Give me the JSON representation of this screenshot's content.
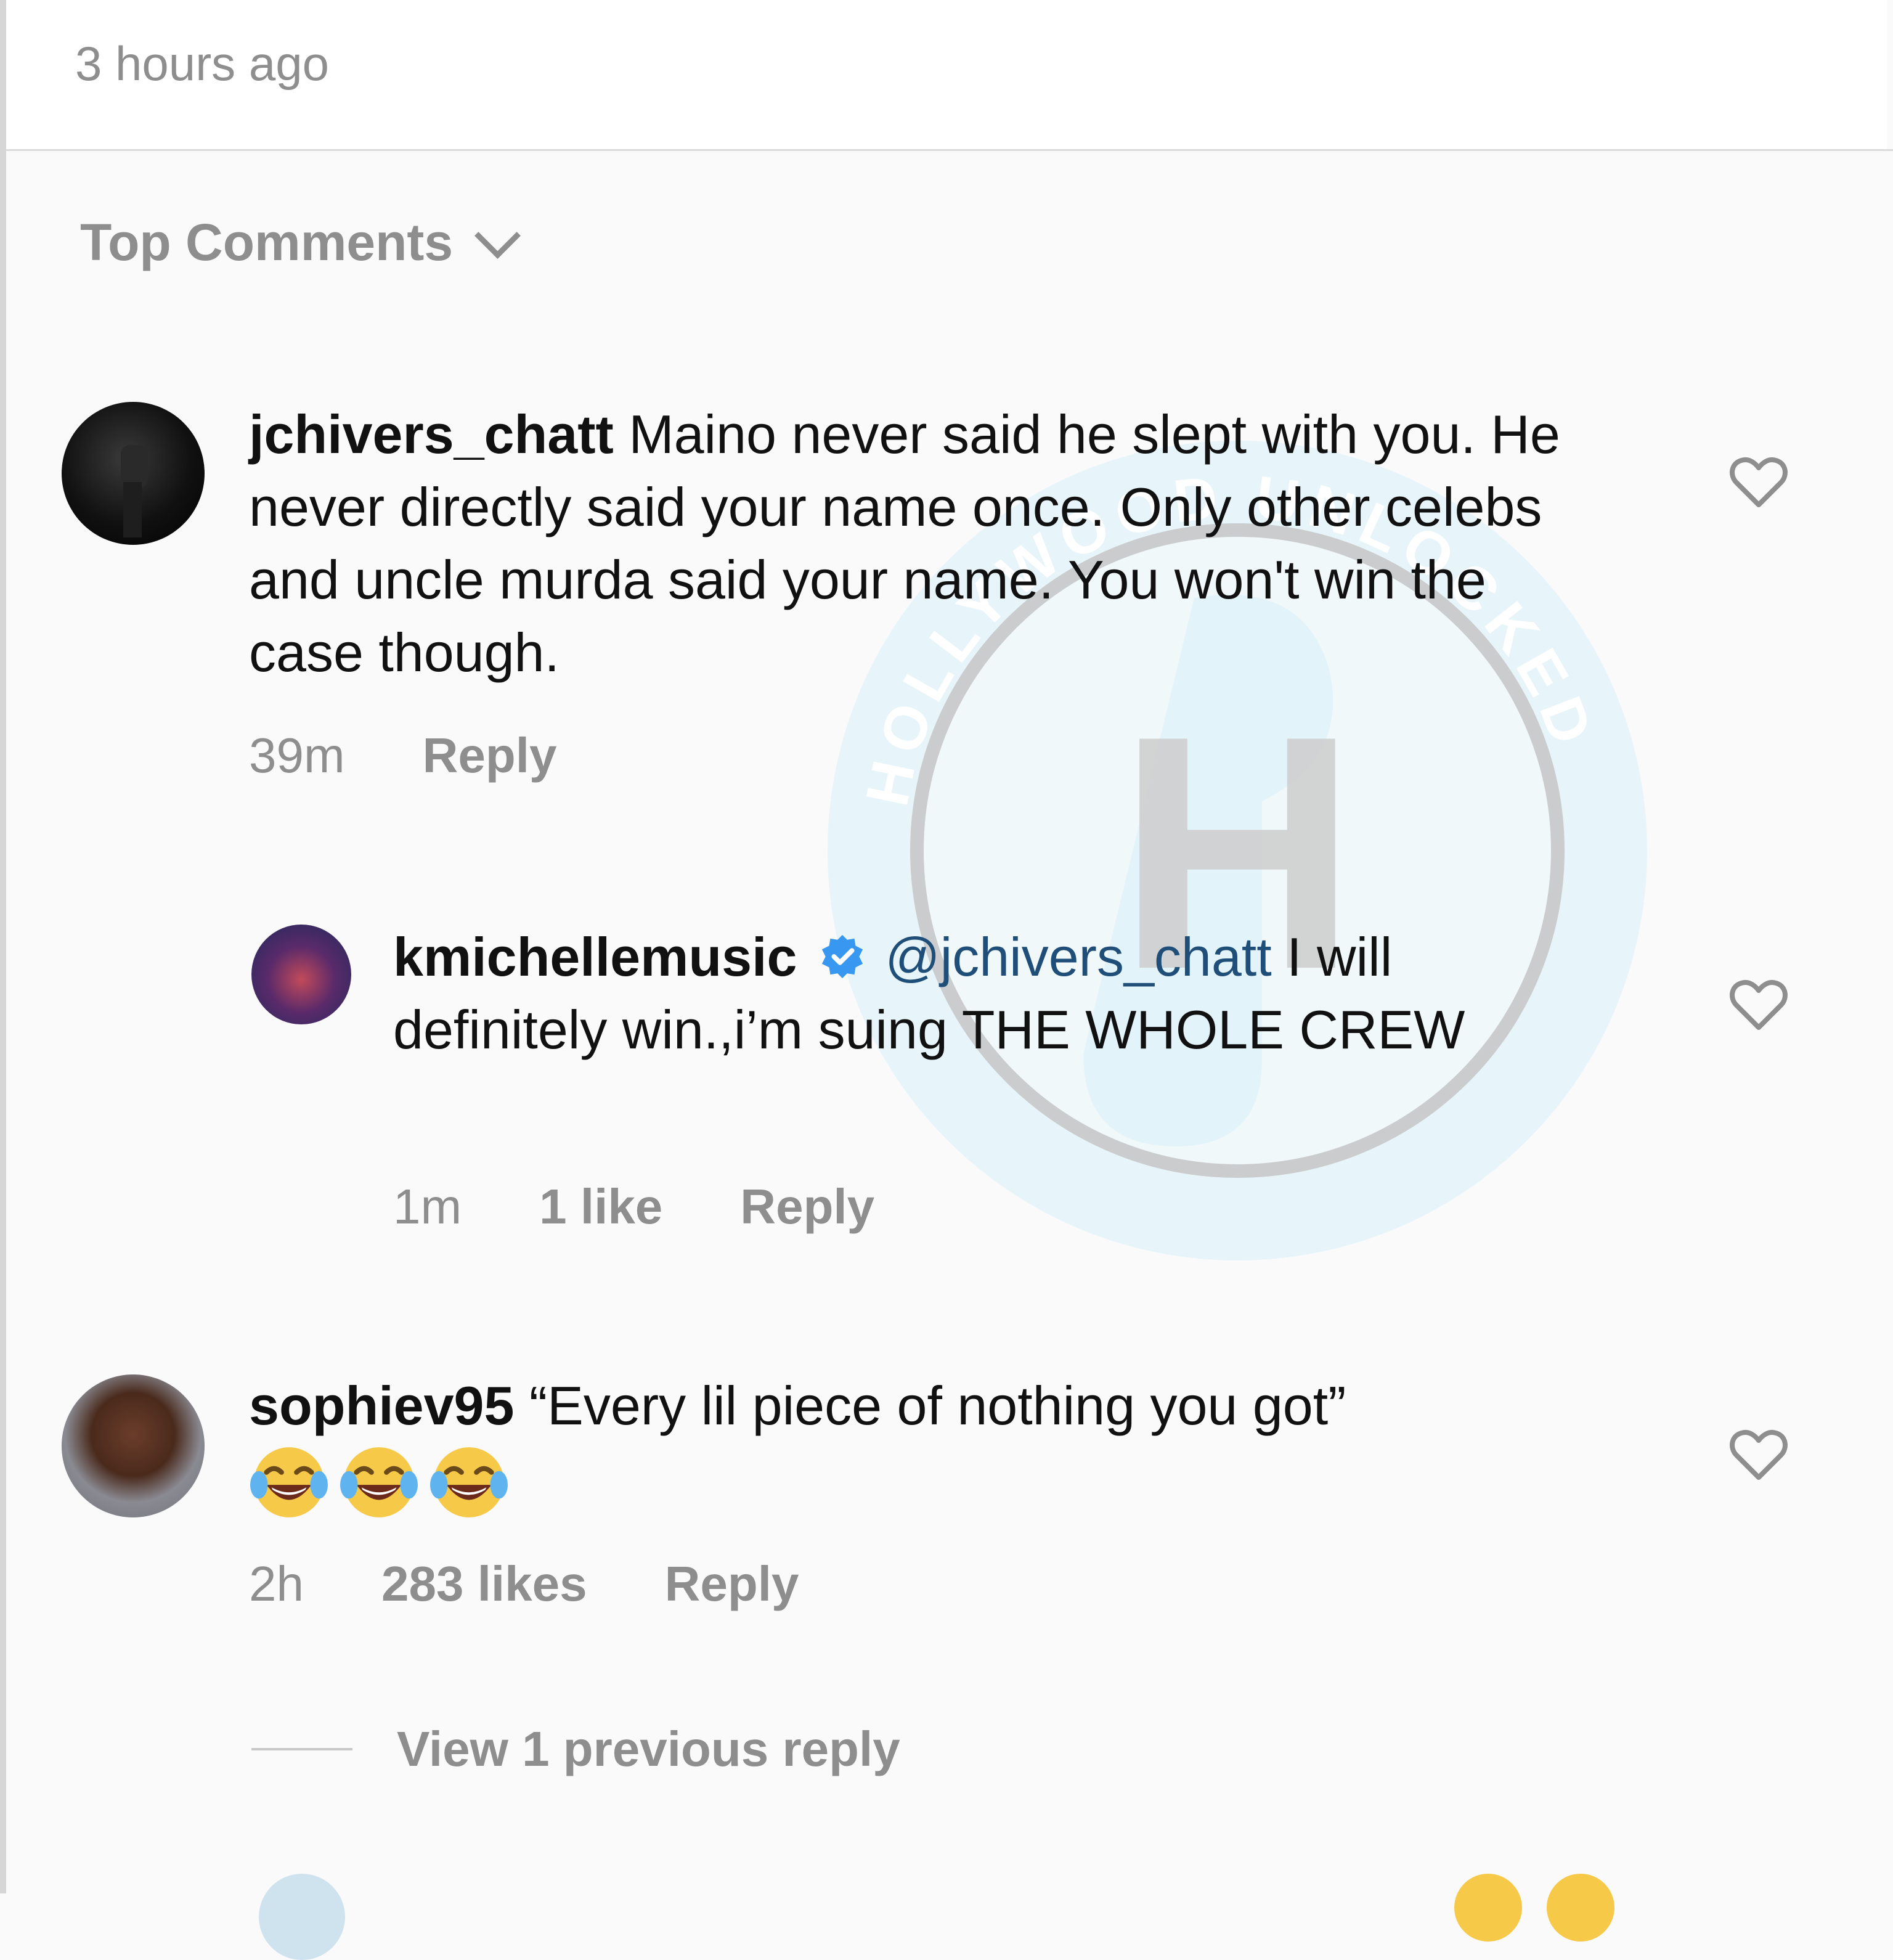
{
  "post": {
    "timestamp": "3 hours ago"
  },
  "sort": {
    "label": "Top Comments"
  },
  "comments": [
    {
      "username": "jchivers_chatt",
      "text": "Maino never said he slept with you. He never directly said your name once. Only other celebs and uncle murda said your name. You won't win the case though.",
      "time": "39m",
      "likes": "",
      "reply_label": "Reply",
      "avatar_icon": "avatar-raised-fist",
      "replies": [
        {
          "username": "kmichellemusic",
          "verified": true,
          "mention": "@jchivers_chatt",
          "text": "I will definitely win.,i’m suing THE WHOLE CREW",
          "time": "1m",
          "likes": "1 like",
          "reply_label": "Reply"
        }
      ]
    },
    {
      "username": "sophiev95",
      "text": "“Every lil piece of nothing you got”",
      "emojis": [
        "face-with-tears-of-joy",
        "face-with-tears-of-joy",
        "face-with-tears-of-joy"
      ],
      "time": "2h",
      "likes": "283 likes",
      "reply_label": "Reply",
      "view_replies_label": "View 1 previous reply"
    }
  ],
  "watermark": {
    "text": "HOLLYWOOD UNLOCKED",
    "letter": "H",
    "colors": {
      "ring": "#d6eef7",
      "inner_ring": "#b5b5b5",
      "letter": "#b8b8b8"
    }
  },
  "colors": {
    "text": "#111111",
    "secondary": "#8e8e8e",
    "mention": "#1f4e79",
    "verified": "#3897f0",
    "background": "#fafafa"
  }
}
